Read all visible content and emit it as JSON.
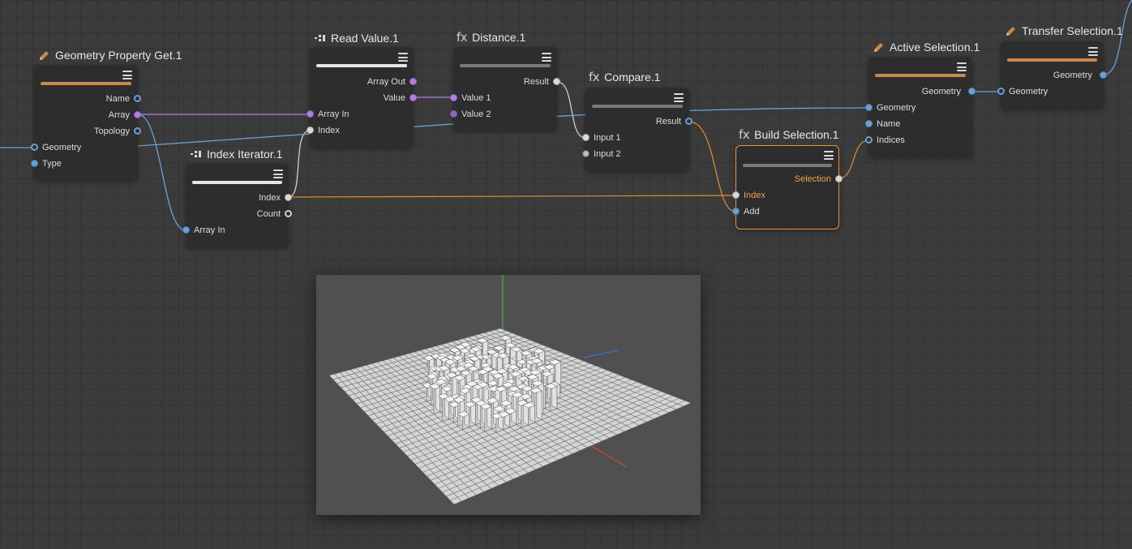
{
  "nodes": {
    "geometry_property_get": {
      "title": "Geometry Property Get.1",
      "outputs": [
        "Name",
        "Array",
        "Topology"
      ],
      "inputs": [
        "Geometry",
        "Type"
      ]
    },
    "read_value": {
      "title": "Read Value.1",
      "outputs": [
        "Array Out",
        "Value"
      ],
      "inputs": [
        "Array In",
        "Index"
      ]
    },
    "distance": {
      "title": "Distance.1",
      "icon_label": "fx",
      "outputs": [
        "Result"
      ],
      "inputs": [
        "Value 1",
        "Value 2"
      ]
    },
    "compare": {
      "title": "Compare.1",
      "icon_label": "fx",
      "outputs": [
        "Result"
      ],
      "inputs": [
        "Input 1",
        "Input 2"
      ]
    },
    "index_iterator": {
      "title": "Index Iterator.1",
      "outputs": [
        "Index",
        "Count"
      ],
      "inputs": [
        "Array In"
      ]
    },
    "build_selection": {
      "title": "Build Selection.1",
      "icon_label": "fx",
      "outputs": [
        "Selection"
      ],
      "inputs": [
        "Index",
        "Add"
      ]
    },
    "active_selection": {
      "title": "Active Selection.1",
      "outputs": [
        "Geometry"
      ],
      "inputs": [
        "Geometry",
        "Name",
        "Indices"
      ]
    },
    "transfer_selection": {
      "title": "Transfer Selection.1",
      "outputs": [
        "Geometry"
      ],
      "inputs": [
        "Geometry"
      ]
    }
  },
  "colors": {
    "port_geometry": "#6aa0d6",
    "port_array": "#b07fe0",
    "port_value": "#d9d9d9",
    "wire_orange": "#d9892f",
    "selected_outline": "#e9953c",
    "node_bar_orange": "#c88a4a"
  },
  "viewport": {
    "icons": [
      "grid-floor",
      "extruded-boxes",
      "axis-x",
      "axis-y",
      "axis-z"
    ]
  }
}
